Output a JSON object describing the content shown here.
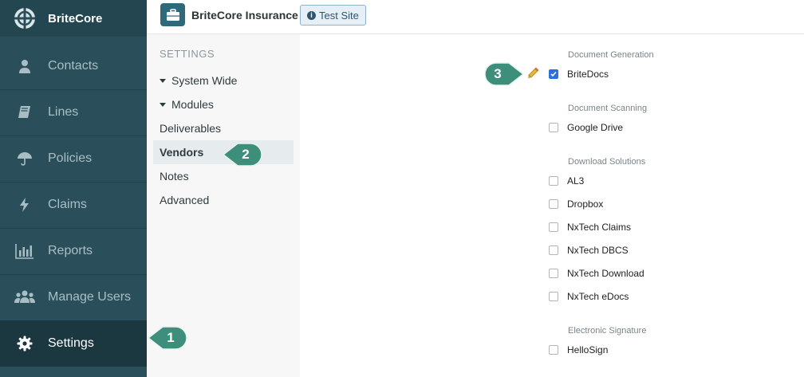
{
  "brand": {
    "name": "BriteCore"
  },
  "nav": [
    {
      "label": "Contacts",
      "icon": "person-icon"
    },
    {
      "label": "Lines",
      "icon": "book-icon"
    },
    {
      "label": "Policies",
      "icon": "umbrella-icon"
    },
    {
      "label": "Claims",
      "icon": "lightning-icon"
    },
    {
      "label": "Reports",
      "icon": "bar-chart-icon"
    },
    {
      "label": "Manage Users",
      "icon": "users-icon"
    },
    {
      "label": "Settings",
      "icon": "gear-icon",
      "active": true
    }
  ],
  "header": {
    "company": "BriteCore Insurance",
    "site_badge": "Test Site"
  },
  "settings_nav": {
    "heading": "SETTINGS",
    "items": [
      {
        "label": "System Wide",
        "expandable": true
      },
      {
        "label": "Modules",
        "expandable": true
      },
      {
        "label": "Deliverables"
      },
      {
        "label": "Vendors",
        "active": true
      },
      {
        "label": "Notes"
      },
      {
        "label": "Advanced"
      }
    ]
  },
  "vendors": {
    "sections": [
      {
        "label": "Document Generation",
        "options": [
          {
            "label": "BriteDocs",
            "checked": true
          }
        ]
      },
      {
        "label": "Document Scanning",
        "options": [
          {
            "label": "Google Drive",
            "checked": false
          }
        ]
      },
      {
        "label": "Download Solutions",
        "options": [
          {
            "label": "AL3",
            "checked": false
          },
          {
            "label": "Dropbox",
            "checked": false
          },
          {
            "label": "NxTech Claims",
            "checked": false
          },
          {
            "label": "NxTech DBCS",
            "checked": false
          },
          {
            "label": "NxTech Download",
            "checked": false
          },
          {
            "label": "NxTech eDocs",
            "checked": false
          }
        ]
      },
      {
        "label": "Electronic Signature",
        "options": [
          {
            "label": "HelloSign",
            "checked": false
          }
        ]
      }
    ]
  },
  "callouts": {
    "one": "1",
    "two": "2",
    "three": "3"
  },
  "colors": {
    "nav_bg": "#2a4f5a",
    "nav_active": "#1b3740",
    "callout": "#3d8f7c",
    "checkbox_checked": "#2f6fdb"
  }
}
